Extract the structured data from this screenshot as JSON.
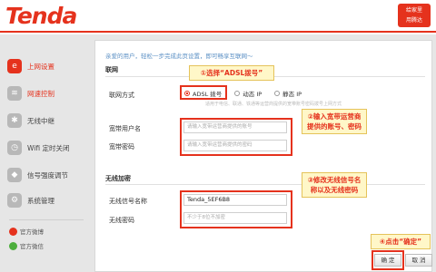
{
  "header": {
    "logo": "Tenda",
    "badge_line1": "给家里",
    "badge_line2": "用腾达"
  },
  "sidebar": {
    "items": [
      {
        "label": "上网设置",
        "icon": "globe-icon"
      },
      {
        "label": "网速控制",
        "icon": "speed-icon"
      },
      {
        "label": "无线中继",
        "icon": "relay-icon"
      },
      {
        "label": "Wifi 定时关闭",
        "icon": "wifi-timer-icon"
      },
      {
        "label": "信号强度调节",
        "icon": "signal-icon"
      },
      {
        "label": "系统管理",
        "icon": "gear-icon"
      }
    ],
    "footer": [
      {
        "label": "官方微博"
      },
      {
        "label": "官方微信"
      }
    ]
  },
  "main": {
    "welcome": "亲爱的用户，轻松一步完成此页设置，即可畅享互联网～",
    "section_wan": "联网",
    "section_wifi": "无线加密",
    "connection_type_label": "联网方式",
    "radio_options": [
      "ADSL 拨号",
      "动态 IP",
      "静态 IP"
    ],
    "radio_hint": "适用于电信、联通、铁通等运营商提供的宽带账号密码拨号上网方式",
    "username_label": "宽带用户名",
    "username_placeholder": "请输入宽带运营商提供的账号",
    "password_label": "宽带密码",
    "password_placeholder": "请输入宽带运营商提供的密码",
    "ssid_label": "无线信号名称",
    "ssid_value": "Tenda_5EF6B8",
    "wifi_password_label": "无线密码",
    "wifi_password_placeholder": "不少于8位不加密"
  },
  "callouts": {
    "c1": "①选择“ADSL拨号”",
    "c2": "②输入宽带运营商提供的账号、密码",
    "c3": "③修改无线信号名称以及无线密码",
    "c4": "④点击“确定”"
  },
  "buttons": {
    "ok": "确 定",
    "cancel": "取 消"
  }
}
